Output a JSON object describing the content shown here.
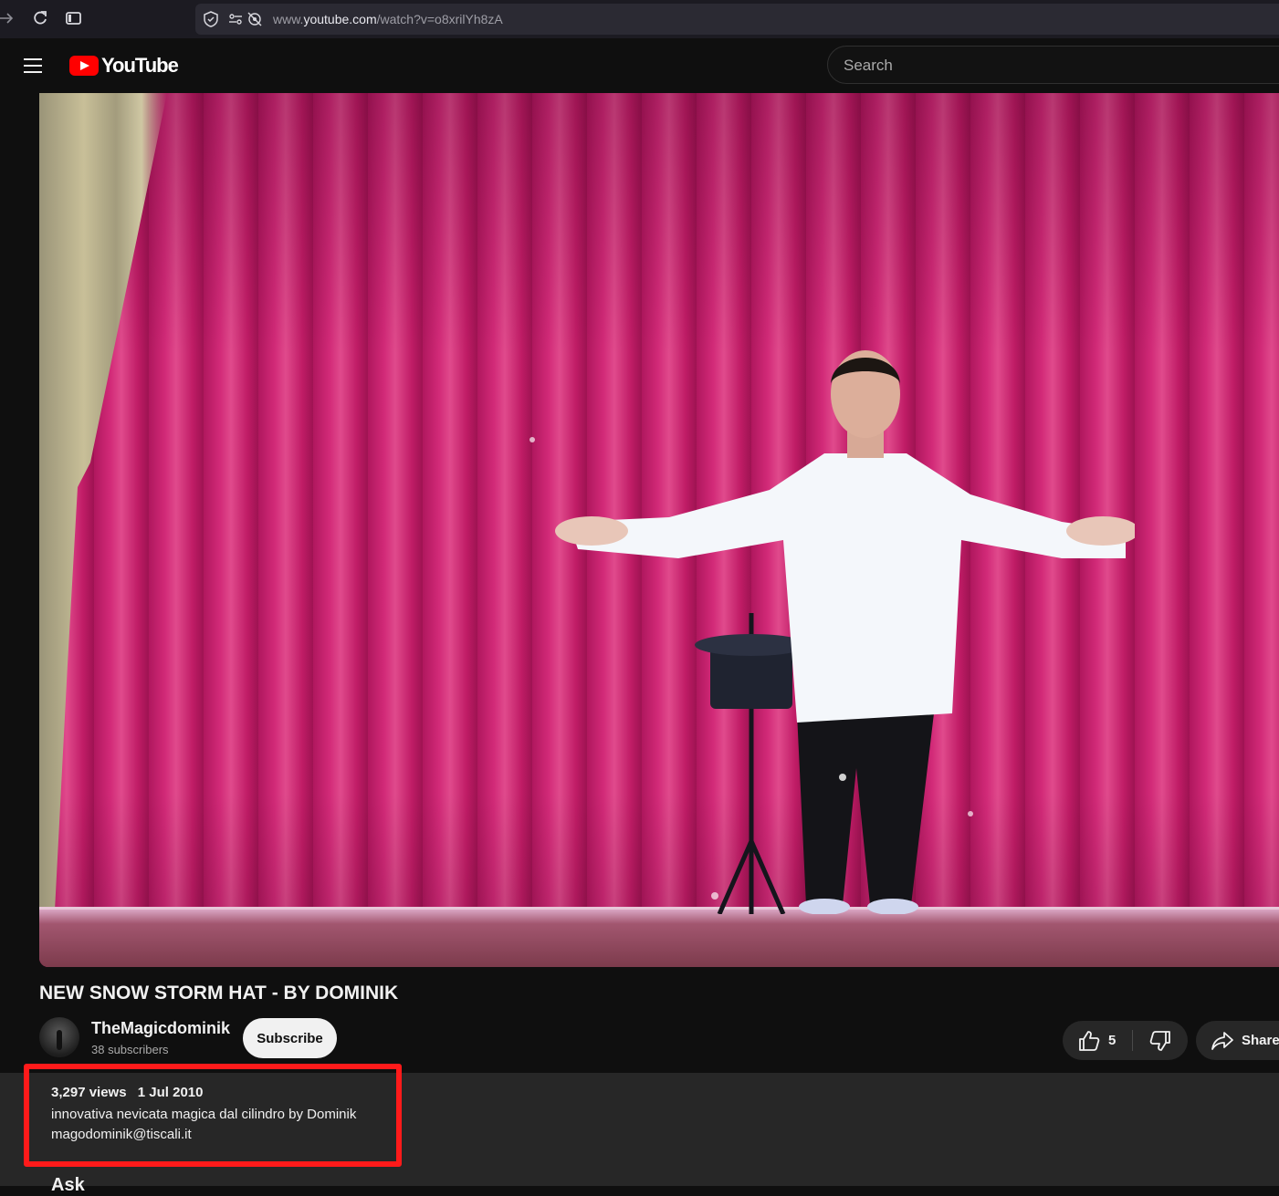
{
  "browser": {
    "url_prefix": "www.",
    "url_domain": "youtube.com",
    "url_path": "/watch?v=o8xrilYh8zA"
  },
  "header": {
    "logo_text": "YouTube",
    "search_placeholder": "Search"
  },
  "video": {
    "title": "NEW SNOW STORM HAT - BY DOMINIK"
  },
  "channel": {
    "name": "TheMagicdominik",
    "subscribers": "38 subscribers",
    "subscribe_label": "Subscribe"
  },
  "actions": {
    "like_count": "5",
    "share_label": "Share"
  },
  "description": {
    "views": "3,297 views",
    "date": "1 Jul 2010",
    "line1": "innovativa nevicata magica dal cilindro by Dominik",
    "line2": "magodominik@tiscali.it",
    "next_section_partial": "Ask"
  },
  "colors": {
    "background": "#0f0f0f",
    "brand_red": "#ff0000",
    "highlight_border": "#ff1a1a",
    "button_bg": "#272727"
  }
}
